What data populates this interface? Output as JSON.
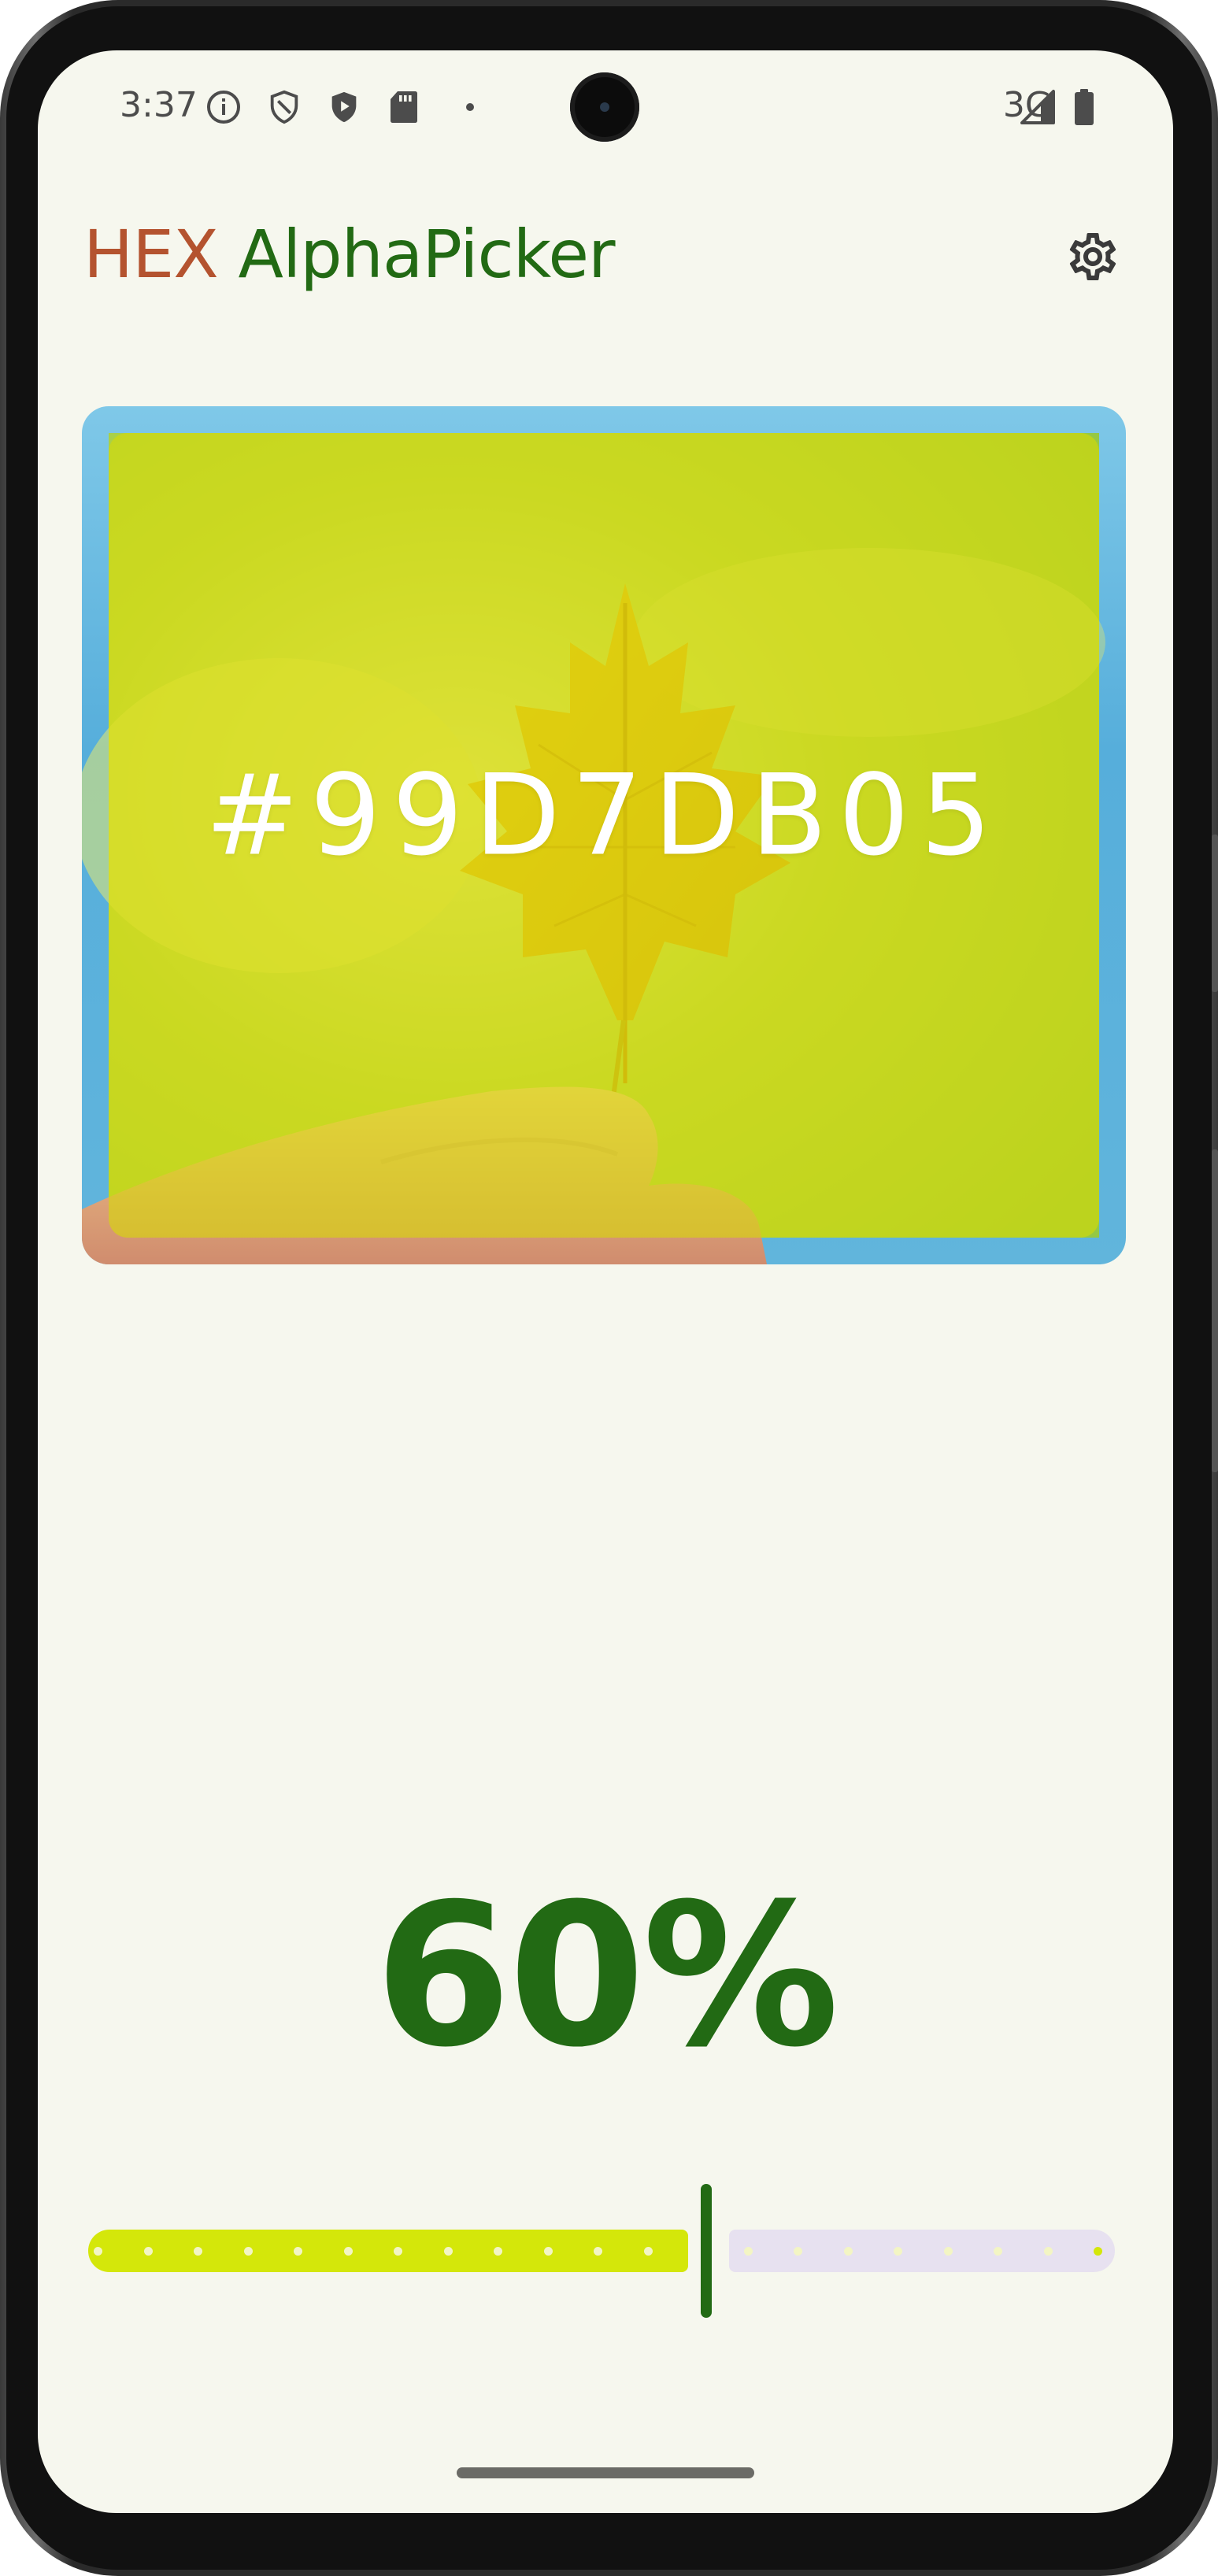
{
  "status_bar": {
    "time": "3:37",
    "network": "3G",
    "icons": [
      "info-icon",
      "shield-icon",
      "play-protect-icon",
      "sd-card-icon",
      "dot-icon",
      "signal-icon",
      "battery-icon"
    ]
  },
  "app_bar": {
    "title_hex": "HEX",
    "title_rest": " AlphaPicker",
    "settings_icon": "gear-icon",
    "colors": {
      "hex": "#b4532f",
      "rest": "#226a14"
    }
  },
  "preview": {
    "hex_code": "#99D7DB05",
    "overlay_color": "#d7db05"
  },
  "alpha": {
    "percent_label": "60%",
    "value": 0.6
  },
  "slider": {
    "active_color": "#d4e70a",
    "inactive_color": "#e7e1f0",
    "thumb_color": "#226a14",
    "steps": 20
  }
}
